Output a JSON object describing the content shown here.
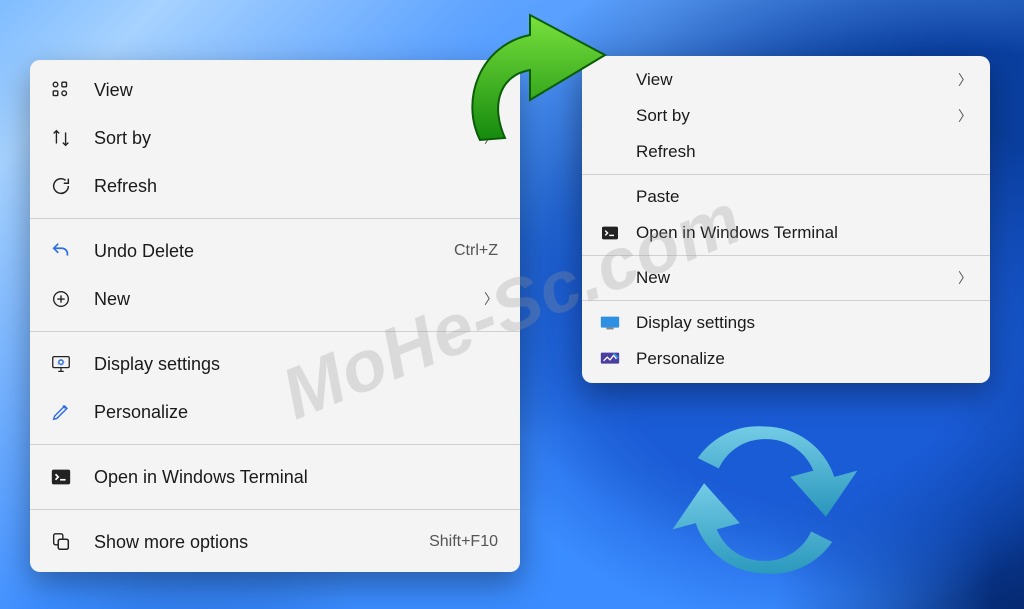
{
  "watermark": "MoHe-Sc.com",
  "menu_left": {
    "items": [
      {
        "id": "view",
        "label": "View",
        "hint": "",
        "submenu": false
      },
      {
        "id": "sort-by",
        "label": "Sort by",
        "hint": "",
        "submenu": true
      },
      {
        "id": "refresh",
        "label": "Refresh",
        "hint": "",
        "submenu": false
      },
      "sep",
      {
        "id": "undo-delete",
        "label": "Undo Delete",
        "hint": "Ctrl+Z",
        "submenu": false
      },
      {
        "id": "new",
        "label": "New",
        "hint": "",
        "submenu": true
      },
      "sep",
      {
        "id": "display-settings",
        "label": "Display settings",
        "hint": "",
        "submenu": false
      },
      {
        "id": "personalize",
        "label": "Personalize",
        "hint": "",
        "submenu": false
      },
      "sep",
      {
        "id": "open-terminal",
        "label": "Open in Windows Terminal",
        "hint": "",
        "submenu": false
      },
      "sep",
      {
        "id": "show-more",
        "label": "Show more options",
        "hint": "Shift+F10",
        "submenu": false
      }
    ]
  },
  "menu_right": {
    "items": [
      {
        "id": "view",
        "label": "View",
        "submenu": true
      },
      {
        "id": "sort-by",
        "label": "Sort by",
        "submenu": true
      },
      {
        "id": "refresh",
        "label": "Refresh",
        "submenu": false
      },
      "sep",
      {
        "id": "paste",
        "label": "Paste",
        "submenu": false
      },
      {
        "id": "open-terminal",
        "label": "Open in Windows Terminal",
        "submenu": false
      },
      "sep",
      {
        "id": "new",
        "label": "New",
        "submenu": true
      },
      "sep",
      {
        "id": "display-settings",
        "label": "Display settings",
        "submenu": false
      },
      {
        "id": "personalize",
        "label": "Personalize",
        "submenu": false
      }
    ]
  }
}
